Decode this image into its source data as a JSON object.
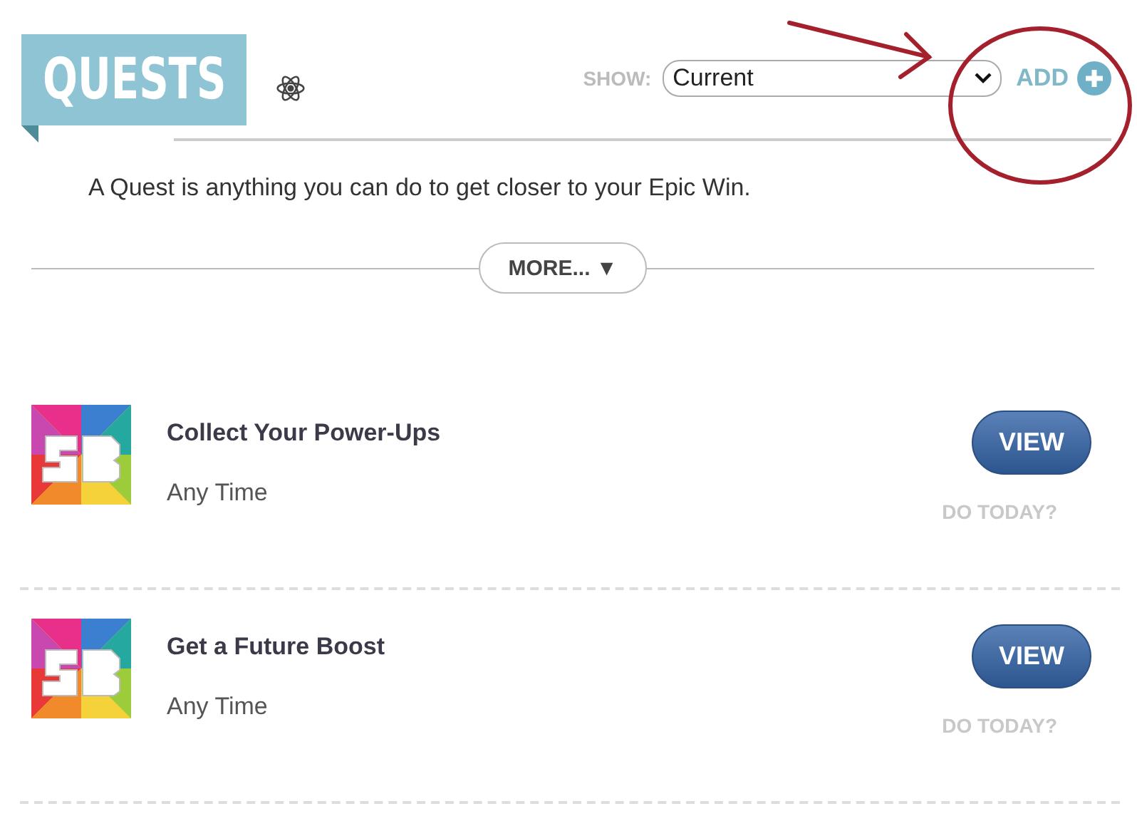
{
  "header": {
    "title": "QUESTS",
    "show_label": "SHOW:",
    "show_select": {
      "value": "Current"
    },
    "add_button": "ADD"
  },
  "description": "A Quest is anything you can do to get closer to your Epic Win.",
  "more_button": "MORE... ▼",
  "quests": [
    {
      "title": "Collect Your Power-Ups",
      "when": "Any Time",
      "view_button": "VIEW",
      "do_today": "DO TODAY?"
    },
    {
      "title": "Get a Future Boost",
      "when": "Any Time",
      "view_button": "VIEW",
      "do_today": "DO TODAY?"
    }
  ]
}
